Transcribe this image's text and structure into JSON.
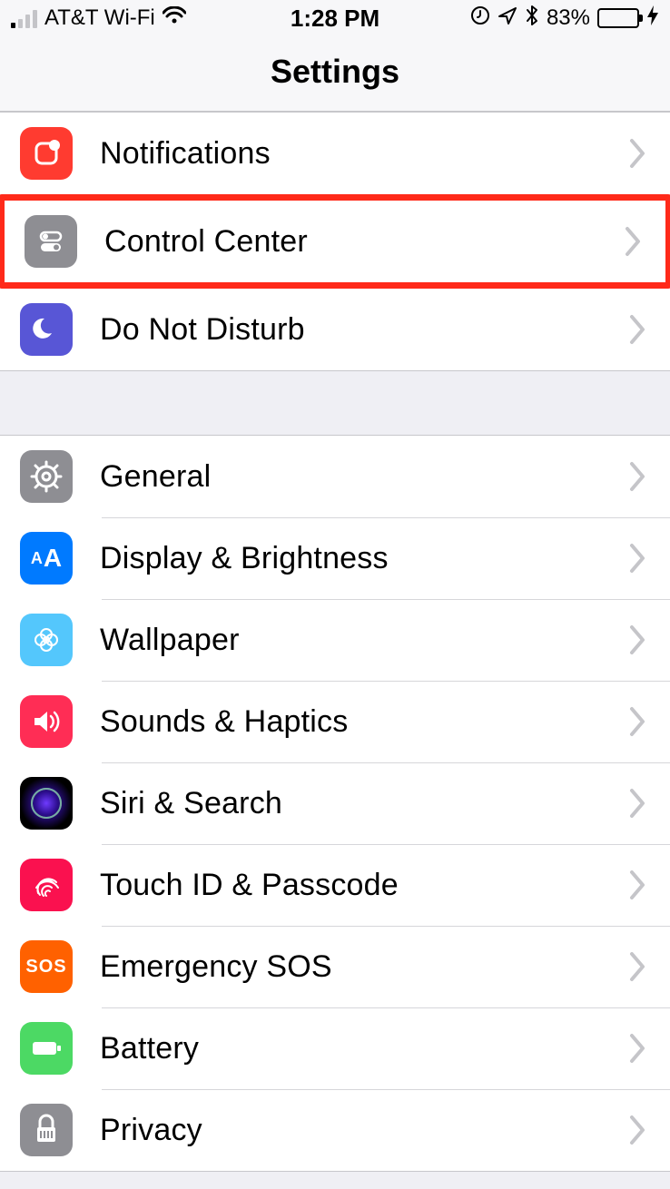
{
  "statusBar": {
    "carrier": "AT&T Wi-Fi",
    "time": "1:28 PM",
    "batteryText": "83%"
  },
  "nav": {
    "title": "Settings"
  },
  "section1": {
    "items": [
      {
        "label": "Notifications"
      },
      {
        "label": "Control Center"
      },
      {
        "label": "Do Not Disturb"
      }
    ]
  },
  "section2": {
    "items": [
      {
        "label": "General"
      },
      {
        "label": "Display & Brightness"
      },
      {
        "label": "Wallpaper"
      },
      {
        "label": "Sounds & Haptics"
      },
      {
        "label": "Siri & Search"
      },
      {
        "label": "Touch ID & Passcode"
      },
      {
        "label": "Emergency SOS"
      },
      {
        "label": "Battery"
      },
      {
        "label": "Privacy"
      }
    ]
  },
  "icons": {
    "sos": "SOS",
    "aa": "AA"
  }
}
